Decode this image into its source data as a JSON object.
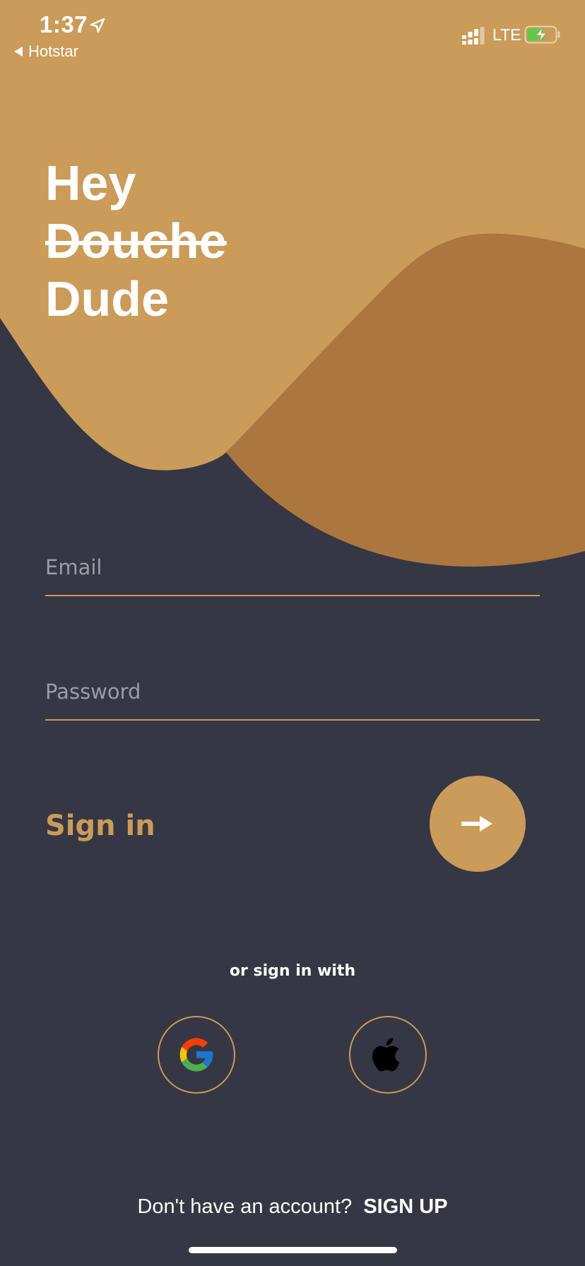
{
  "status_bar": {
    "time": "1:37",
    "back_app": "Hotstar",
    "network": "LTE"
  },
  "hero": {
    "line1": "Hey",
    "line2": "Douche",
    "line3": "Dude"
  },
  "form": {
    "email_placeholder": "Email",
    "email_value": "",
    "password_placeholder": "Password",
    "password_value": "",
    "signin_label": "Sign in"
  },
  "social": {
    "label": "or sign in with",
    "providers": [
      "google-icon",
      "apple-icon"
    ]
  },
  "footer": {
    "prompt": "Don't have an account?",
    "signup_label": "SIGN UP"
  },
  "colors": {
    "background": "#363744",
    "accent": "#cb9b5a",
    "accent_dark": "#ab773e",
    "text": "#ffffff",
    "placeholder": "#9c9ca6"
  }
}
